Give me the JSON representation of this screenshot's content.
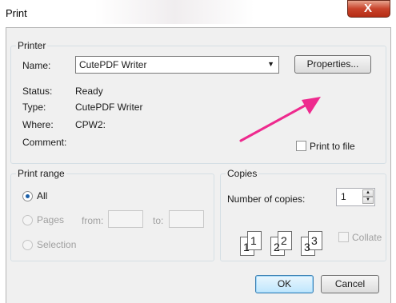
{
  "window": {
    "title": "Print",
    "close_glyph": "X"
  },
  "printer": {
    "legend": "Printer",
    "name_label": "Name:",
    "name_value": "CutePDF Writer",
    "properties_label": "Properties...",
    "status_label": "Status:",
    "status_value": "Ready",
    "type_label": "Type:",
    "type_value": "CutePDF Writer",
    "where_label": "Where:",
    "where_value": "CPW2:",
    "comment_label": "Comment:",
    "print_to_file_label": "Print to file"
  },
  "print_range": {
    "legend": "Print range",
    "all_label": "All",
    "pages_label": "Pages",
    "from_label": "from:",
    "to_label": "to:",
    "selection_label": "Selection"
  },
  "copies": {
    "legend": "Copies",
    "number_label": "Number of copies:",
    "number_value": "1",
    "collate_label": "Collate",
    "page_numbers": [
      "1",
      "1",
      "2",
      "2",
      "3",
      "3"
    ]
  },
  "buttons": {
    "ok_label": "OK",
    "cancel_label": "Cancel"
  },
  "colors": {
    "annotation_arrow": "#ee2a8e",
    "close_button": "#c8432b"
  }
}
